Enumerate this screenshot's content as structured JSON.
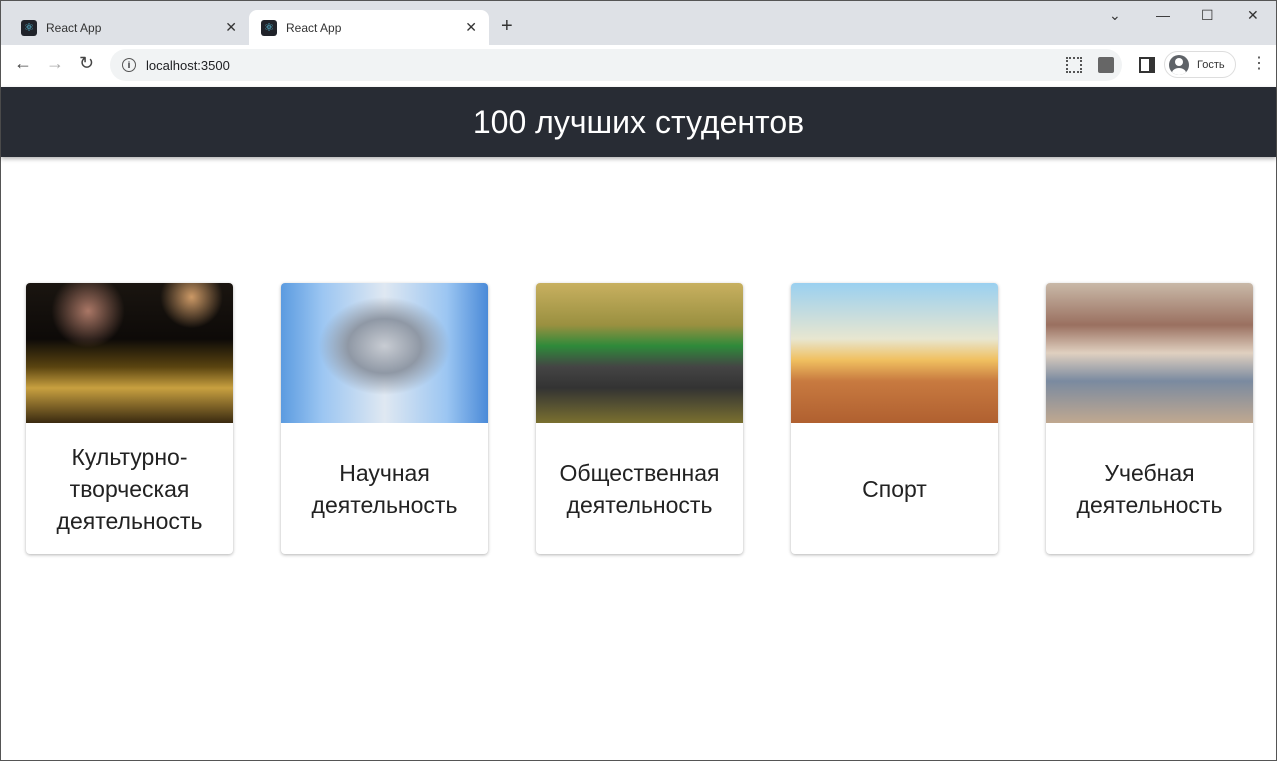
{
  "browser": {
    "tabs": [
      {
        "label": "React App",
        "active": false
      },
      {
        "label": "React App",
        "active": true
      }
    ],
    "url": "localhost:3500",
    "profile_label": "Гость"
  },
  "header": {
    "title": "100 лучших студентов"
  },
  "cards": [
    {
      "title": "Культурно-творческая деятельность",
      "image": "illuminated theater building with fireworks"
    },
    {
      "title": "Научная деятельность",
      "image": "microscope with gloved hands"
    },
    {
      "title": "Общественная деятельность",
      "image": "volunteers with trash bags in forest"
    },
    {
      "title": "Спорт",
      "image": "runners at sunset"
    },
    {
      "title": "Учебная деятельность",
      "image": "students in lecture hall"
    }
  ]
}
